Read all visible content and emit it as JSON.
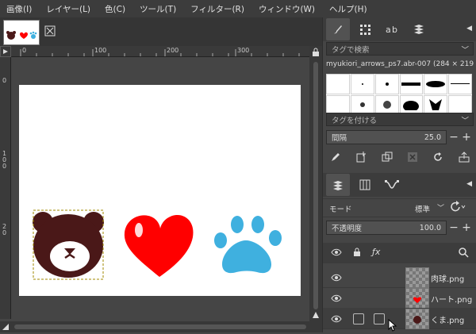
{
  "menu": [
    "画像(I)",
    "レイヤー(L)",
    "色(C)",
    "ツール(T)",
    "フィルター(R)",
    "ウィンドウ(W)",
    "ヘルプ(H)"
  ],
  "image_tab": {
    "close_icon": "close-icon"
  },
  "ruler": {
    "h_labels": [
      "0",
      "100",
      "200",
      "300"
    ],
    "v_labels": [
      "0",
      "1 0 0",
      "2 0"
    ]
  },
  "dock_top": {
    "tabs": [
      "brush-icon",
      "grid-pattern-icon",
      "font-icon",
      "stack-icon"
    ],
    "search_placeholder": "タグで検索",
    "brush_name": "myukiori_arrows_ps7.abr-007 (284 × 219)",
    "tag_placeholder": "タグを付ける",
    "spacing_label": "間隔",
    "spacing_value": "25.0"
  },
  "dock_bottom": {
    "tabs": [
      "layers-icon",
      "channels-icon",
      "paths-icon"
    ],
    "mode_label": "モード",
    "mode_value": "標準",
    "opacity_label": "不透明度",
    "opacity_value": "100.0"
  },
  "layers": [
    {
      "name": "肉球.png",
      "visible": true
    },
    {
      "name": "ハート.png",
      "visible": true
    },
    {
      "name": "くま.png",
      "visible": true
    }
  ],
  "colors": {
    "bear": "#4a1818",
    "heart": "#ff0000",
    "paw": "#3fb0df"
  }
}
